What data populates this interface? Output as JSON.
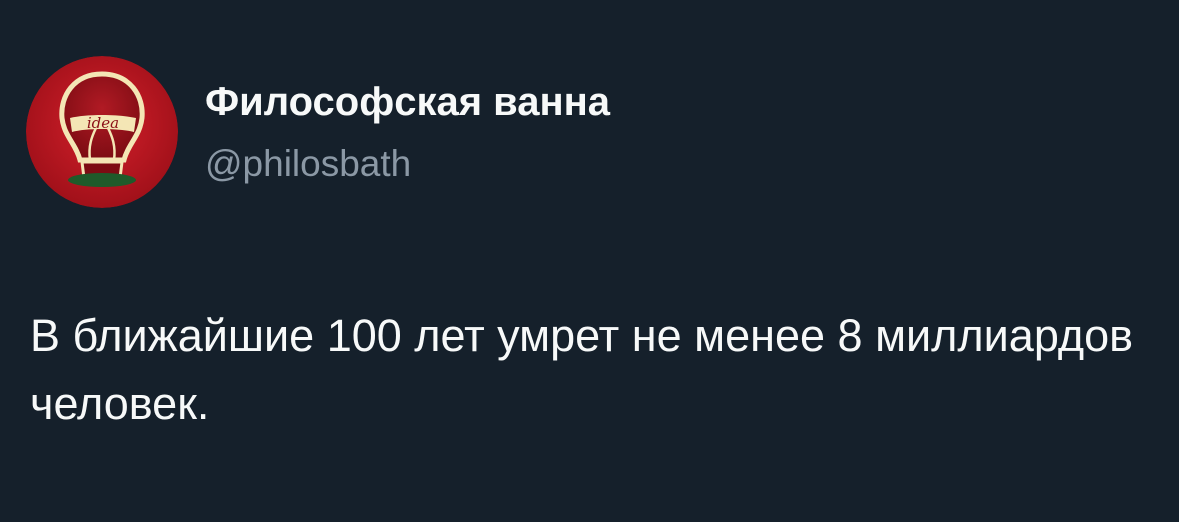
{
  "author": {
    "display_name": "Философская ванна",
    "handle": "@philosbath",
    "avatar_text": "idea"
  },
  "tweet": {
    "text": "В ближайшие 100 лет умрет не менее 8 миллиардов человек."
  },
  "colors": {
    "background": "#15202b",
    "primary_text": "#f7f9f9",
    "secondary_text": "#8b98a5",
    "avatar_red": "#b8151f",
    "avatar_cream": "#f4e6b5",
    "avatar_green": "#1f5a2a"
  }
}
